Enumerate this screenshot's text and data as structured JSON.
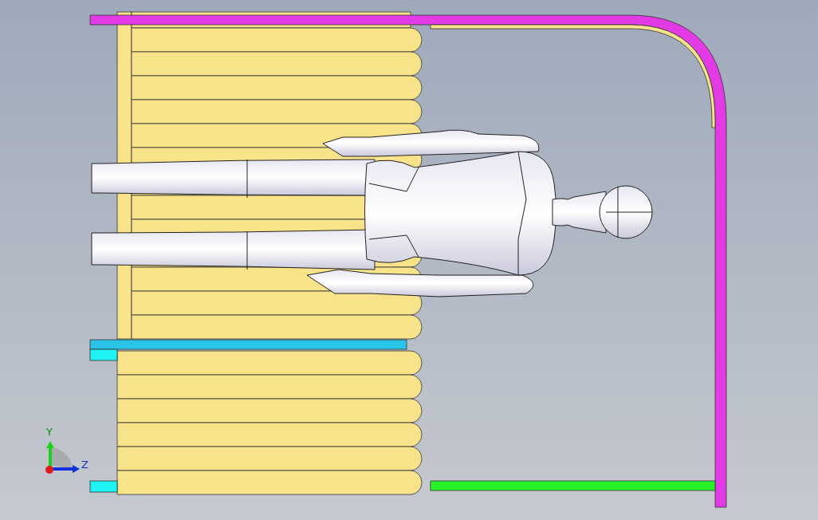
{
  "viewport": {
    "triad": {
      "axes": [
        {
          "kind": "vertical",
          "label": "Y"
        },
        {
          "kind": "horizontal",
          "label": "Z"
        }
      ]
    }
  }
}
